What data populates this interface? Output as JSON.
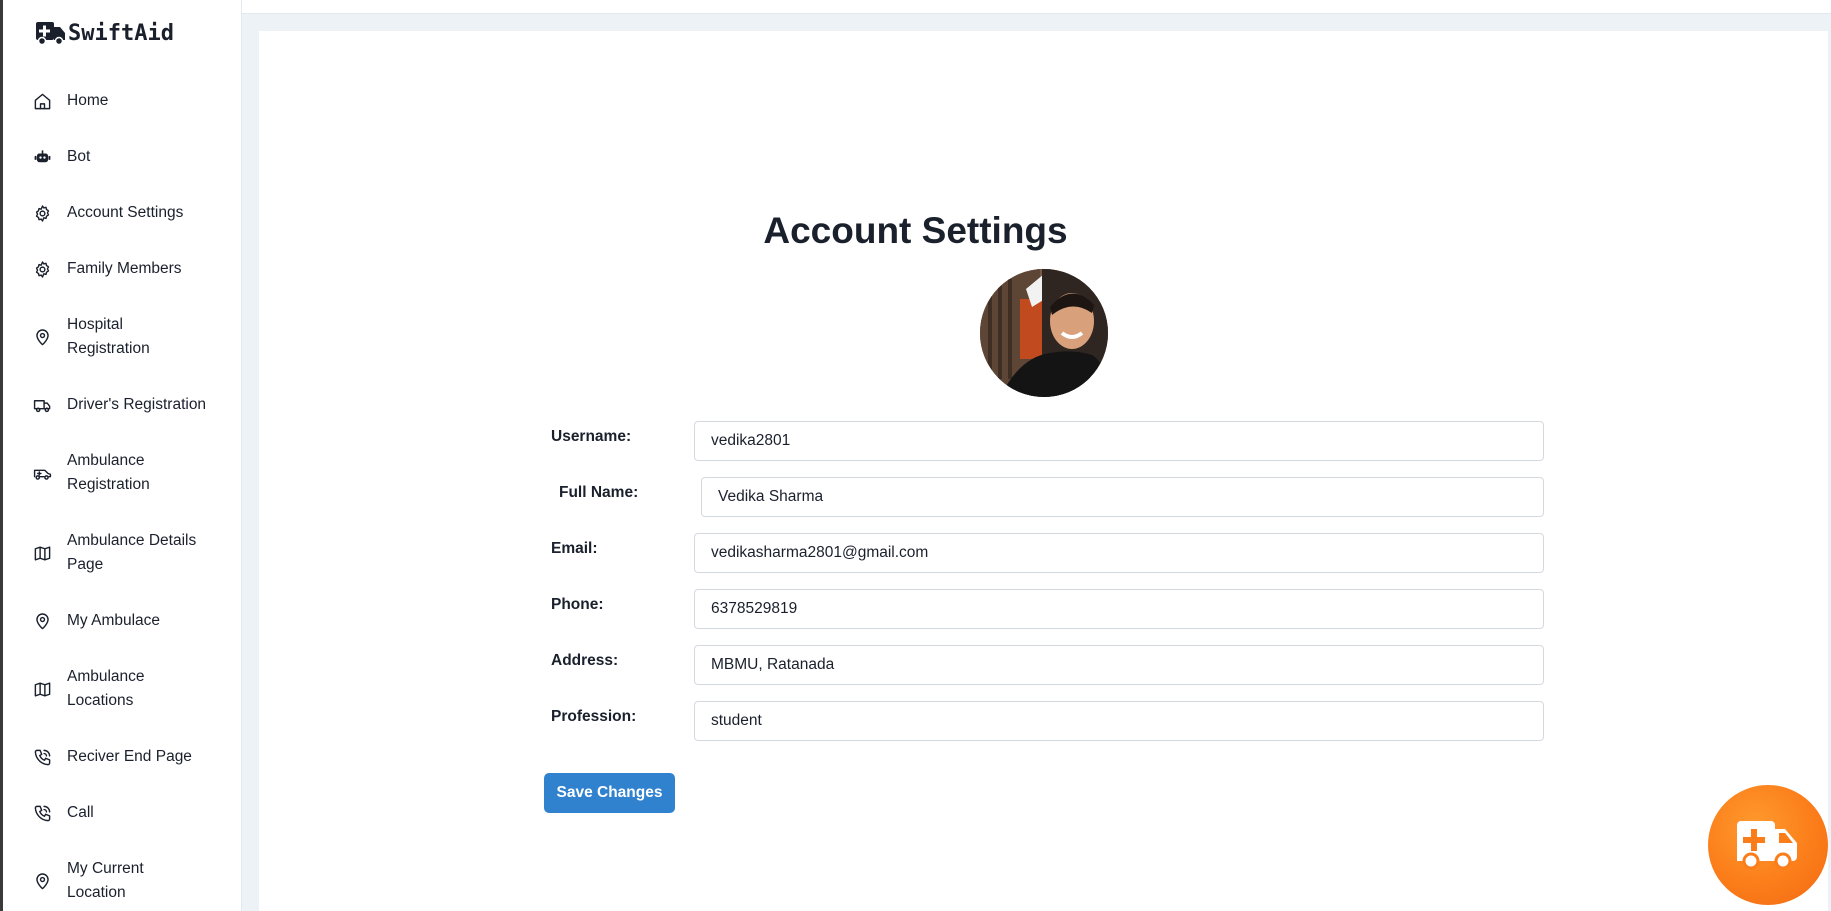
{
  "brand": {
    "name": "SwiftAid",
    "icon": "ambulance-icon"
  },
  "sidebar": {
    "items": [
      {
        "label": "Home",
        "icon": "home-icon"
      },
      {
        "label": "Bot",
        "icon": "bot-icon"
      },
      {
        "label": "Account Settings",
        "icon": "gear-icon"
      },
      {
        "label": "Family Members",
        "icon": "gear-icon"
      },
      {
        "label": "Hospital Registration",
        "icon": "map-pin-icon"
      },
      {
        "label": "Driver's Registration",
        "icon": "truck-icon"
      },
      {
        "label": "Ambulance Registration",
        "icon": "ambulance-icon"
      },
      {
        "label": "Ambulance Details Page",
        "icon": "map-icon"
      },
      {
        "label": "My Ambulace",
        "icon": "map-pin-icon"
      },
      {
        "label": "Ambulance Locations",
        "icon": "map-icon"
      },
      {
        "label": "Reciver End Page",
        "icon": "phone-call-icon"
      },
      {
        "label": "Call",
        "icon": "phone-call-icon"
      },
      {
        "label": "My Current Location",
        "icon": "map-pin-icon"
      }
    ]
  },
  "page": {
    "title": "Account Settings"
  },
  "form": {
    "username": {
      "label": "Username:",
      "value": "vedika2801"
    },
    "full_name": {
      "label": "Full Name:",
      "value": "Vedika Sharma"
    },
    "email": {
      "label": "Email:",
      "value": "vedikasharma2801@gmail.com"
    },
    "phone": {
      "label": "Phone:",
      "value": "6378529819"
    },
    "address": {
      "label": "Address:",
      "value": "MBMU, Ratanada"
    },
    "profession": {
      "label": "Profession:",
      "value": "student"
    },
    "save_label": "Save Changes"
  },
  "fab": {
    "icon": "ambulance-icon"
  },
  "colors": {
    "accent": "#3182ce",
    "fab": "#fb7d1a",
    "background": "#edf2f7",
    "text": "#1a202c"
  }
}
